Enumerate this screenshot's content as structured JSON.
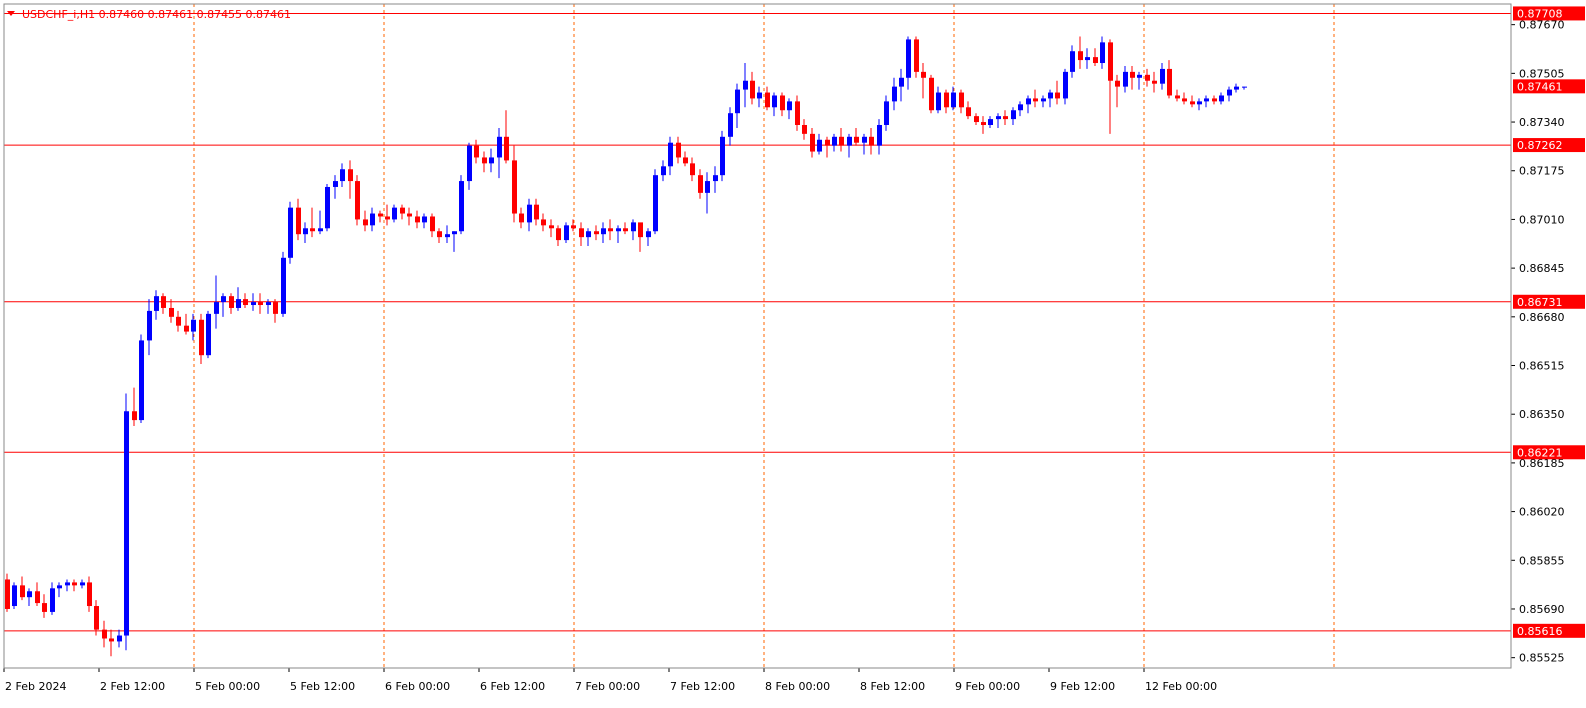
{
  "chart_data": {
    "type": "candlestick",
    "symbol_header": "USDCHF_i,H1  0.87460 0.87461 0.87455 0.87461",
    "colors": {
      "background": "#ffffff",
      "bull": "#0000ff",
      "bear": "#ff0000",
      "grid": "#ff6600",
      "hline": "#ff0000",
      "label_bg": "#ff0000",
      "label_text": "#ffffff",
      "axis_text": "#000000",
      "title_text": "#ff0000"
    },
    "price_range": [
      0.8549,
      0.8774
    ],
    "y_ticks": [
      "0.87670",
      "0.87505",
      "0.87340",
      "0.87175",
      "0.87010",
      "0.86845",
      "0.86680",
      "0.86515",
      "0.86350",
      "0.86185",
      "0.86020",
      "0.85855",
      "0.85690",
      "0.85525"
    ],
    "x_labels": [
      "2 Feb 2024",
      "2 Feb 12:00",
      "5 Feb 00:00",
      "5 Feb 12:00",
      "6 Feb 00:00",
      "6 Feb 12:00",
      "7 Feb 00:00",
      "7 Feb 12:00",
      "8 Feb 00:00",
      "8 Feb 12:00",
      "9 Feb 00:00",
      "9 Feb 12:00",
      "12 Feb 00:00"
    ],
    "horizontal_levels": [
      {
        "price": 0.87708,
        "label": "0.87708"
      },
      {
        "price": 0.87262,
        "label": "0.87262"
      },
      {
        "price": 0.86731,
        "label": "0.86731"
      },
      {
        "price": 0.86221,
        "label": "0.86221"
      },
      {
        "price": 0.85616,
        "label": "0.85616"
      }
    ],
    "current_price": {
      "price": 0.87461,
      "label": "0.87461"
    },
    "candles": [
      [
        0.8579,
        0.8581,
        0.8568,
        0.8569
      ],
      [
        0.857,
        0.8578,
        0.8569,
        0.8577
      ],
      [
        0.8577,
        0.858,
        0.8572,
        0.8573
      ],
      [
        0.8573,
        0.8576,
        0.857,
        0.8575
      ],
      [
        0.8575,
        0.8578,
        0.857,
        0.8571
      ],
      [
        0.8571,
        0.8574,
        0.8566,
        0.8568
      ],
      [
        0.8568,
        0.8578,
        0.8567,
        0.8576
      ],
      [
        0.8576,
        0.8578,
        0.8573,
        0.8577
      ],
      [
        0.8577,
        0.8579,
        0.8575,
        0.8578
      ],
      [
        0.8578,
        0.8579,
        0.8575,
        0.8577
      ],
      [
        0.8577,
        0.8579,
        0.8576,
        0.8578
      ],
      [
        0.8578,
        0.858,
        0.8568,
        0.857
      ],
      [
        0.857,
        0.8572,
        0.856,
        0.8562
      ],
      [
        0.8562,
        0.8565,
        0.8556,
        0.8559
      ],
      [
        0.8559,
        0.8562,
        0.8553,
        0.8558
      ],
      [
        0.8558,
        0.8562,
        0.8556,
        0.856
      ],
      [
        0.856,
        0.8642,
        0.8555,
        0.8636
      ],
      [
        0.8636,
        0.8644,
        0.8631,
        0.8633
      ],
      [
        0.8633,
        0.8662,
        0.8632,
        0.866
      ],
      [
        0.866,
        0.8674,
        0.8655,
        0.867
      ],
      [
        0.867,
        0.8677,
        0.8667,
        0.8675
      ],
      [
        0.8675,
        0.8676,
        0.8669,
        0.8671
      ],
      [
        0.8671,
        0.8674,
        0.8666,
        0.8668
      ],
      [
        0.8668,
        0.867,
        0.8663,
        0.8665
      ],
      [
        0.8665,
        0.8669,
        0.8662,
        0.8663
      ],
      [
        0.8663,
        0.8669,
        0.866,
        0.8667
      ],
      [
        0.8667,
        0.8669,
        0.8652,
        0.8655
      ],
      [
        0.8655,
        0.867,
        0.8654,
        0.8669
      ],
      [
        0.8669,
        0.8682,
        0.8664,
        0.8673
      ],
      [
        0.8673,
        0.8676,
        0.8668,
        0.8675
      ],
      [
        0.8675,
        0.8676,
        0.8669,
        0.8671
      ],
      [
        0.8671,
        0.8678,
        0.867,
        0.8674
      ],
      [
        0.8674,
        0.8676,
        0.8671,
        0.8672
      ],
      [
        0.8672,
        0.8676,
        0.867,
        0.8673
      ],
      [
        0.8673,
        0.8676,
        0.8669,
        0.8672
      ],
      [
        0.8672,
        0.8674,
        0.8669,
        0.8673
      ],
      [
        0.8673,
        0.8674,
        0.8666,
        0.8669
      ],
      [
        0.8669,
        0.869,
        0.8668,
        0.8688
      ],
      [
        0.8688,
        0.8707,
        0.8686,
        0.8705
      ],
      [
        0.8705,
        0.8708,
        0.8694,
        0.8696
      ],
      [
        0.8696,
        0.87,
        0.8693,
        0.8698
      ],
      [
        0.8698,
        0.8705,
        0.8695,
        0.8697
      ],
      [
        0.8697,
        0.8704,
        0.8696,
        0.8698
      ],
      [
        0.8698,
        0.8713,
        0.8697,
        0.8712
      ],
      [
        0.8712,
        0.8716,
        0.8708,
        0.8714
      ],
      [
        0.8714,
        0.872,
        0.8712,
        0.8718
      ],
      [
        0.8718,
        0.8721,
        0.8708,
        0.8714
      ],
      [
        0.8714,
        0.8716,
        0.8699,
        0.8701
      ],
      [
        0.8701,
        0.8704,
        0.8697,
        0.8699
      ],
      [
        0.8699,
        0.8705,
        0.8697,
        0.8703
      ],
      [
        0.8703,
        0.8704,
        0.87,
        0.8702
      ],
      [
        0.8702,
        0.8706,
        0.8699,
        0.8701
      ],
      [
        0.8701,
        0.8706,
        0.87,
        0.8705
      ],
      [
        0.8705,
        0.8706,
        0.8701,
        0.8703
      ],
      [
        0.8703,
        0.8705,
        0.8699,
        0.8702
      ],
      [
        0.8702,
        0.8704,
        0.8698,
        0.87
      ],
      [
        0.87,
        0.8703,
        0.8698,
        0.8702
      ],
      [
        0.8702,
        0.8703,
        0.8695,
        0.8697
      ],
      [
        0.8697,
        0.8698,
        0.8693,
        0.8695
      ],
      [
        0.8695,
        0.8699,
        0.8693,
        0.8696
      ],
      [
        0.8696,
        0.8697,
        0.869,
        0.8697
      ],
      [
        0.8697,
        0.8716,
        0.8696,
        0.8714
      ],
      [
        0.8714,
        0.8727,
        0.8711,
        0.8726
      ],
      [
        0.8726,
        0.8728,
        0.872,
        0.8722
      ],
      [
        0.8722,
        0.8724,
        0.8717,
        0.872
      ],
      [
        0.872,
        0.8725,
        0.8717,
        0.8722
      ],
      [
        0.8722,
        0.8732,
        0.8715,
        0.8729
      ],
      [
        0.8729,
        0.8738,
        0.872,
        0.8721
      ],
      [
        0.8721,
        0.8726,
        0.87,
        0.8703
      ],
      [
        0.8703,
        0.8705,
        0.8698,
        0.87
      ],
      [
        0.87,
        0.8708,
        0.8697,
        0.8706
      ],
      [
        0.8706,
        0.8708,
        0.8699,
        0.8701
      ],
      [
        0.8701,
        0.8703,
        0.8697,
        0.8699
      ],
      [
        0.8699,
        0.8701,
        0.8695,
        0.8698
      ],
      [
        0.8698,
        0.8699,
        0.8692,
        0.8694
      ],
      [
        0.8694,
        0.87,
        0.8693,
        0.8699
      ],
      [
        0.8699,
        0.8701,
        0.8697,
        0.8698
      ],
      [
        0.8698,
        0.87,
        0.8692,
        0.8695
      ],
      [
        0.8695,
        0.8698,
        0.8692,
        0.8697
      ],
      [
        0.8697,
        0.8699,
        0.8694,
        0.8696
      ],
      [
        0.8696,
        0.87,
        0.8693,
        0.8698
      ],
      [
        0.8698,
        0.8701,
        0.8694,
        0.8697
      ],
      [
        0.8697,
        0.8699,
        0.8693,
        0.8698
      ],
      [
        0.8698,
        0.87,
        0.8696,
        0.8697
      ],
      [
        0.8697,
        0.8701,
        0.8694,
        0.87
      ],
      [
        0.87,
        0.8698,
        0.869,
        0.8695
      ],
      [
        0.8695,
        0.8698,
        0.8692,
        0.8697
      ],
      [
        0.8697,
        0.8718,
        0.8696,
        0.8716
      ],
      [
        0.8716,
        0.8721,
        0.8714,
        0.8719
      ],
      [
        0.8719,
        0.8729,
        0.8716,
        0.8727
      ],
      [
        0.8727,
        0.8729,
        0.872,
        0.8722
      ],
      [
        0.8722,
        0.8724,
        0.8719,
        0.872
      ],
      [
        0.872,
        0.8722,
        0.8714,
        0.8716
      ],
      [
        0.8716,
        0.8718,
        0.8708,
        0.871
      ],
      [
        0.871,
        0.8717,
        0.8703,
        0.8714
      ],
      [
        0.8714,
        0.8719,
        0.871,
        0.8716
      ],
      [
        0.8716,
        0.8731,
        0.8714,
        0.8729
      ],
      [
        0.8729,
        0.8739,
        0.8726,
        0.8737
      ],
      [
        0.8737,
        0.8747,
        0.8732,
        0.8745
      ],
      [
        0.8745,
        0.8754,
        0.8739,
        0.8748
      ],
      [
        0.8748,
        0.8751,
        0.874,
        0.8742
      ],
      [
        0.8742,
        0.8746,
        0.8739,
        0.8744
      ],
      [
        0.8744,
        0.8746,
        0.8738,
        0.8739
      ],
      [
        0.8739,
        0.8744,
        0.8736,
        0.8743
      ],
      [
        0.8743,
        0.8744,
        0.8736,
        0.8738
      ],
      [
        0.8738,
        0.8742,
        0.8735,
        0.8741
      ],
      [
        0.8741,
        0.8743,
        0.8731,
        0.8733
      ],
      [
        0.8733,
        0.8735,
        0.8728,
        0.873
      ],
      [
        0.873,
        0.8732,
        0.8722,
        0.8724
      ],
      [
        0.8724,
        0.873,
        0.8723,
        0.8728
      ],
      [
        0.8728,
        0.8729,
        0.8722,
        0.8726
      ],
      [
        0.8726,
        0.873,
        0.8724,
        0.8729
      ],
      [
        0.8729,
        0.8732,
        0.8724,
        0.8726
      ],
      [
        0.8726,
        0.873,
        0.8722,
        0.8729
      ],
      [
        0.8729,
        0.8732,
        0.8726,
        0.8727
      ],
      [
        0.8727,
        0.873,
        0.8723,
        0.8729
      ],
      [
        0.8729,
        0.8732,
        0.8723,
        0.8726
      ],
      [
        0.8726,
        0.8735,
        0.8723,
        0.8733
      ],
      [
        0.8733,
        0.8743,
        0.8731,
        0.8741
      ],
      [
        0.8741,
        0.8749,
        0.8738,
        0.8746
      ],
      [
        0.8746,
        0.8752,
        0.8741,
        0.8749
      ],
      [
        0.8749,
        0.8763,
        0.8745,
        0.8762
      ],
      [
        0.8762,
        0.8763,
        0.8749,
        0.8751
      ],
      [
        0.8751,
        0.8754,
        0.8742,
        0.8749
      ],
      [
        0.8749,
        0.875,
        0.8737,
        0.8738
      ],
      [
        0.8738,
        0.8746,
        0.8737,
        0.8744
      ],
      [
        0.8744,
        0.8745,
        0.8737,
        0.8739
      ],
      [
        0.8739,
        0.8746,
        0.8738,
        0.8744
      ],
      [
        0.8744,
        0.8745,
        0.8737,
        0.8739
      ],
      [
        0.8739,
        0.8741,
        0.8735,
        0.8736
      ],
      [
        0.8736,
        0.8737,
        0.8733,
        0.8734
      ],
      [
        0.8734,
        0.8736,
        0.873,
        0.8733
      ],
      [
        0.8733,
        0.8736,
        0.8732,
        0.8735
      ],
      [
        0.8735,
        0.8737,
        0.8732,
        0.8736
      ],
      [
        0.8736,
        0.8738,
        0.8733,
        0.8735
      ],
      [
        0.8735,
        0.8739,
        0.8733,
        0.8738
      ],
      [
        0.8738,
        0.8741,
        0.8736,
        0.874
      ],
      [
        0.874,
        0.8743,
        0.8737,
        0.8742
      ],
      [
        0.8742,
        0.8745,
        0.8739,
        0.8741
      ],
      [
        0.8741,
        0.8743,
        0.8739,
        0.8742
      ],
      [
        0.8742,
        0.8745,
        0.8739,
        0.8744
      ],
      [
        0.8744,
        0.8748,
        0.874,
        0.8742
      ],
      [
        0.8742,
        0.8752,
        0.874,
        0.8751
      ],
      [
        0.8751,
        0.876,
        0.8749,
        0.8758
      ],
      [
        0.8758,
        0.8763,
        0.8752,
        0.8755
      ],
      [
        0.8755,
        0.8759,
        0.8752,
        0.8756
      ],
      [
        0.8756,
        0.8759,
        0.8753,
        0.8754
      ],
      [
        0.8754,
        0.8763,
        0.8752,
        0.8761
      ],
      [
        0.8761,
        0.8762,
        0.873,
        0.8748
      ],
      [
        0.8748,
        0.875,
        0.8739,
        0.8746
      ],
      [
        0.8746,
        0.8753,
        0.8744,
        0.8751
      ],
      [
        0.8751,
        0.8753,
        0.8745,
        0.8749
      ],
      [
        0.8749,
        0.8751,
        0.8745,
        0.875
      ],
      [
        0.875,
        0.8752,
        0.8746,
        0.8748
      ],
      [
        0.8748,
        0.8751,
        0.8744,
        0.8747
      ],
      [
        0.8747,
        0.8754,
        0.8745,
        0.8752
      ],
      [
        0.8752,
        0.8755,
        0.8742,
        0.8743
      ],
      [
        0.8743,
        0.8745,
        0.8741,
        0.8742
      ],
      [
        0.8742,
        0.8744,
        0.874,
        0.8741
      ],
      [
        0.8741,
        0.8743,
        0.8739,
        0.874
      ],
      [
        0.874,
        0.8742,
        0.8738,
        0.8741
      ],
      [
        0.8741,
        0.8743,
        0.8739,
        0.8742
      ],
      [
        0.8742,
        0.8743,
        0.874,
        0.8741
      ],
      [
        0.8741,
        0.8744,
        0.874,
        0.8743
      ],
      [
        0.8743,
        0.8746,
        0.8741,
        0.8745
      ],
      [
        0.8745,
        0.8747,
        0.8744,
        0.8746
      ],
      [
        0.8746,
        0.8746,
        0.8745,
        0.8746
      ]
    ]
  }
}
